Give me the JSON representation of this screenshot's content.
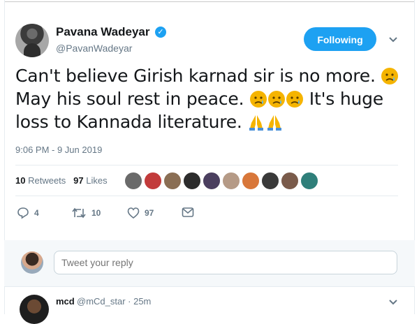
{
  "tweet": {
    "author_name": "Pavana Wadeyar",
    "author_handle": "@PavanWadeyar",
    "follow_label": "Following",
    "text_line1": "Can't believe Girish karnad sir is no more. ",
    "text_line2": "May his soul rest in peace. ",
    "text_line2b": " It's huge",
    "text_line3": "loss to Kannada literature. ",
    "timestamp": "9:06 PM - 9 Jun 2019",
    "retweets_count": "10",
    "retweets_label": "Retweets",
    "likes_count": "97",
    "likes_label": "Likes",
    "actions": {
      "reply_count": "4",
      "retweet_count": "10",
      "like_count": "97"
    }
  },
  "reply_box": {
    "placeholder": "Tweet your reply"
  },
  "reply": {
    "name": "mcd",
    "meta": "@mCd_star · 25m"
  },
  "colors": {
    "accent": "#1da1f2",
    "emoji": "#f5b400"
  },
  "icons": [
    "verified-icon",
    "chevron-down-icon",
    "reply-icon",
    "retweet-icon",
    "like-icon",
    "dm-icon",
    "sad-emoji-icon",
    "pray-emoji-icon"
  ]
}
